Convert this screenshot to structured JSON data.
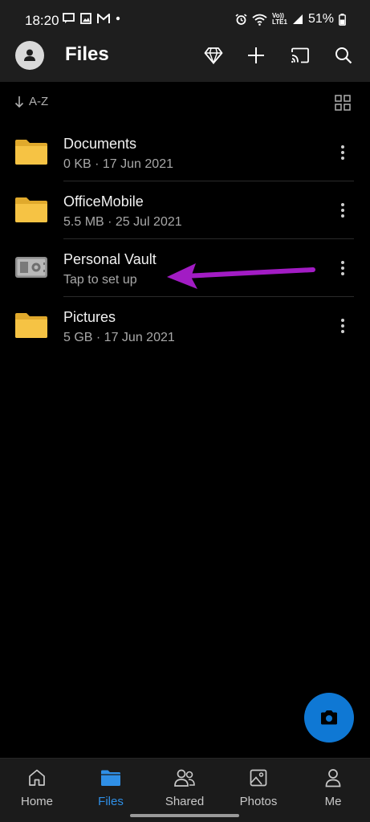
{
  "status_bar": {
    "time": "18:20",
    "battery": "51%",
    "network_label_top": "Vo))",
    "network_label_bottom": "LTE1"
  },
  "app_bar": {
    "title": "Files"
  },
  "sort": {
    "label": "A-Z"
  },
  "files": [
    {
      "name": "Documents",
      "meta": "0 KB · 17 Jun 2021",
      "icon": "folder-icon"
    },
    {
      "name": "OfficeMobile",
      "meta": "5.5 MB · 25 Jul 2021",
      "icon": "folder-icon"
    },
    {
      "name": "Personal Vault",
      "meta": "Tap to set up",
      "icon": "vault-icon"
    },
    {
      "name": "Pictures",
      "meta": "5 GB · 17 Jun 2021",
      "icon": "folder-icon"
    }
  ],
  "bottom_nav": {
    "items": [
      {
        "label": "Home",
        "icon": "home-icon",
        "active": false
      },
      {
        "label": "Files",
        "icon": "folder-icon",
        "active": true
      },
      {
        "label": "Shared",
        "icon": "people-icon",
        "active": false
      },
      {
        "label": "Photos",
        "icon": "photo-icon",
        "active": false
      },
      {
        "label": "Me",
        "icon": "person-icon",
        "active": false
      }
    ]
  },
  "colors": {
    "accent": "#0f78d4",
    "active_nav": "#2f8fe6",
    "folder": "#f6c344",
    "annotation_arrow": "#a21cc4"
  }
}
